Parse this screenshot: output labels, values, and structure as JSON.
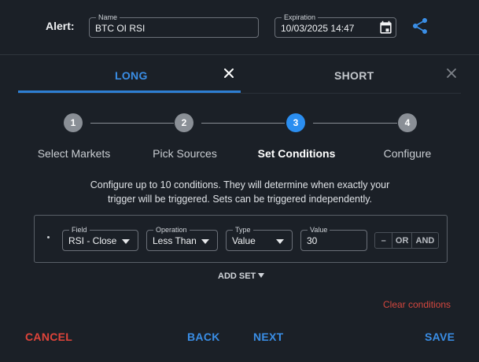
{
  "header": {
    "alert_label": "Alert:",
    "name_legend": "Name",
    "name_value": "BTC OI RSI",
    "expiration_legend": "Expiration",
    "expiration_value": "10/03/2025 14:47",
    "calendar_icon": "calendar-icon",
    "share_icon": "share-icon"
  },
  "tabs": [
    {
      "label": "LONG",
      "active": true
    },
    {
      "label": "SHORT",
      "active": false
    }
  ],
  "steps": [
    {
      "number": "1",
      "label": "Select Markets",
      "active": false
    },
    {
      "number": "2",
      "label": "Pick Sources",
      "active": false
    },
    {
      "number": "3",
      "label": "Set Conditions",
      "active": true
    },
    {
      "number": "4",
      "label": "Configure",
      "active": false
    }
  ],
  "description": "Configure up to 10 conditions. They will determine when exactly your trigger will be triggered. Sets can be triggered independently.",
  "condition": {
    "field_legend": "Field",
    "field_value": "RSI - Close",
    "operation_legend": "Operation",
    "operation_value": "Less Than",
    "type_legend": "Type",
    "type_value": "Value",
    "value_legend": "Value",
    "value_value": "30",
    "group_buttons": [
      "–",
      "OR",
      "AND"
    ]
  },
  "add_set_label": "ADD SET",
  "clear_conditions_label": "Clear conditions",
  "footer": {
    "cancel": "CANCEL",
    "back": "BACK",
    "next": "NEXT",
    "save": "SAVE"
  },
  "colors": {
    "accent": "#2b8ef0",
    "danger": "#e0443a",
    "background": "#1b2027"
  }
}
